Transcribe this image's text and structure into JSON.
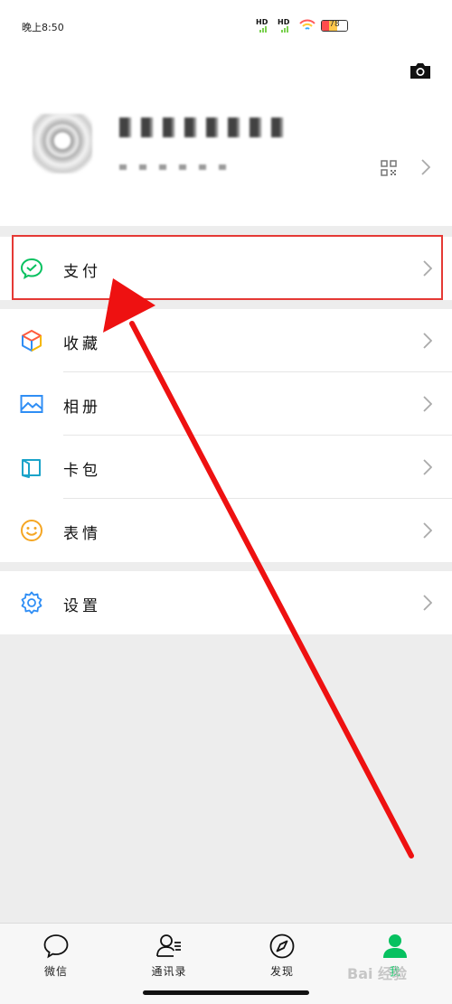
{
  "status": {
    "time": "晚上8:50",
    "signal_1": "HD",
    "signal_2": "HD",
    "battery": "78"
  },
  "profile": {
    "icons": [
      "camera-icon",
      "qr-code-icon",
      "chevron-right-icon"
    ]
  },
  "menu": {
    "pay": "支付",
    "favorites": "收藏",
    "album": "相册",
    "cards": "卡包",
    "stickers": "表情",
    "settings": "设置"
  },
  "tabs": {
    "chats": "微信",
    "contacts": "通讯录",
    "discover": "发现",
    "me": "我"
  },
  "watermark": "Bai 经验",
  "colors": {
    "wechat_green": "#07c160",
    "highlight_red": "#e53935",
    "arrow_red": "#ee1111"
  }
}
